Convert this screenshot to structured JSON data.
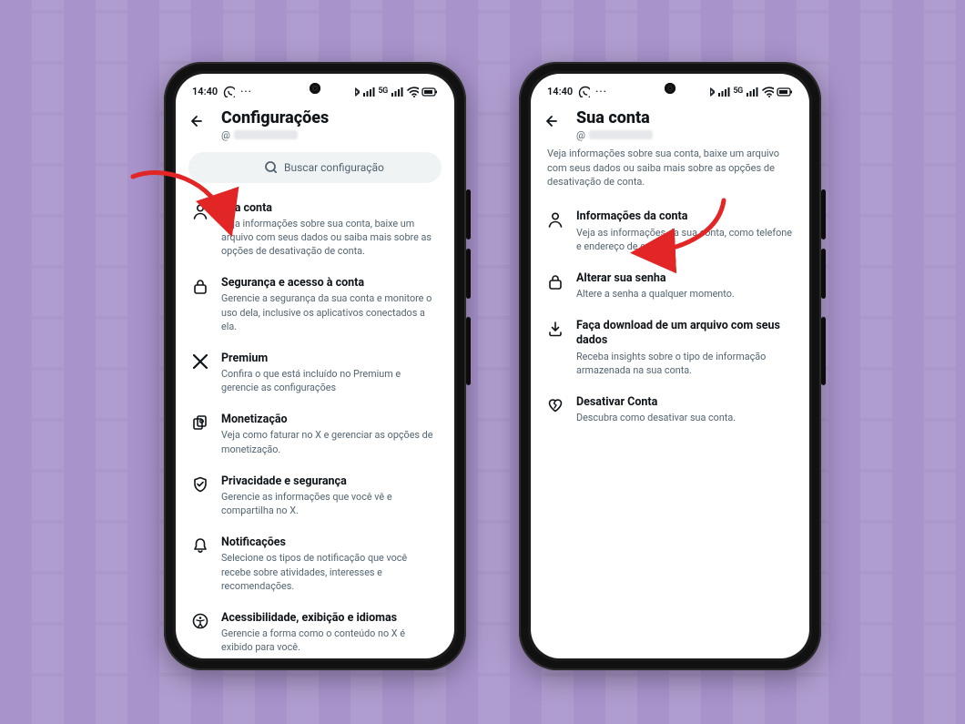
{
  "status": {
    "time": "14:40",
    "whatsapp_icon": "whatsapp",
    "more": "···",
    "right_text": "5G"
  },
  "phone1": {
    "title": "Configurações",
    "handle_prefix": "@",
    "search_placeholder": "Buscar configuração",
    "items": [
      {
        "icon": "person",
        "title": "Sua conta",
        "desc": "Veja informações sobre sua conta, baixe um arquivo com seus dados ou saiba mais sobre as opções de desativação de conta."
      },
      {
        "icon": "lock",
        "title": "Segurança e acesso à conta",
        "desc": "Gerencie a segurança da sua conta e monitore o uso dela, inclusive os aplicativos conectados a ela."
      },
      {
        "icon": "x",
        "title": "Premium",
        "desc": "Confira o que está incluído no Premium e gerencie as configurações"
      },
      {
        "icon": "coins",
        "title": "Monetização",
        "desc": "Veja como faturar no X e gerenciar as opções de monetização."
      },
      {
        "icon": "shield",
        "title": "Privacidade e segurança",
        "desc": "Gerencie as informações que você vê e compartilha no X."
      },
      {
        "icon": "bell",
        "title": "Notificações",
        "desc": "Selecione os tipos de notificação que você recebe sobre atividades, interesses e recomendações."
      },
      {
        "icon": "accessibility",
        "title": "Acessibilidade, exibição e idiomas",
        "desc": "Gerencie a forma como o conteúdo no X é exibido para você."
      }
    ]
  },
  "phone2": {
    "title": "Sua conta",
    "handle_prefix": "@",
    "intro": "Veja informações sobre sua conta, baixe um arquivo com seus dados ou saiba mais sobre as opções de desativação de conta.",
    "items": [
      {
        "icon": "person",
        "title": "Informações da conta",
        "desc": "Veja as informações da sua conta, como telefone e endereço de e-mail."
      },
      {
        "icon": "lock",
        "title": "Alterar sua senha",
        "desc": "Altere a senha a qualquer momento."
      },
      {
        "icon": "download",
        "title": "Faça download de um arquivo com seus dados",
        "desc": "Receba insights sobre o tipo de informação armazenada na sua conta."
      },
      {
        "icon": "heart-broken",
        "title": "Desativar Conta",
        "desc": "Descubra como desativar sua conta."
      }
    ]
  },
  "annotations": {
    "arrow1_target": "Sua conta",
    "arrow2_target": "Informações da conta"
  }
}
